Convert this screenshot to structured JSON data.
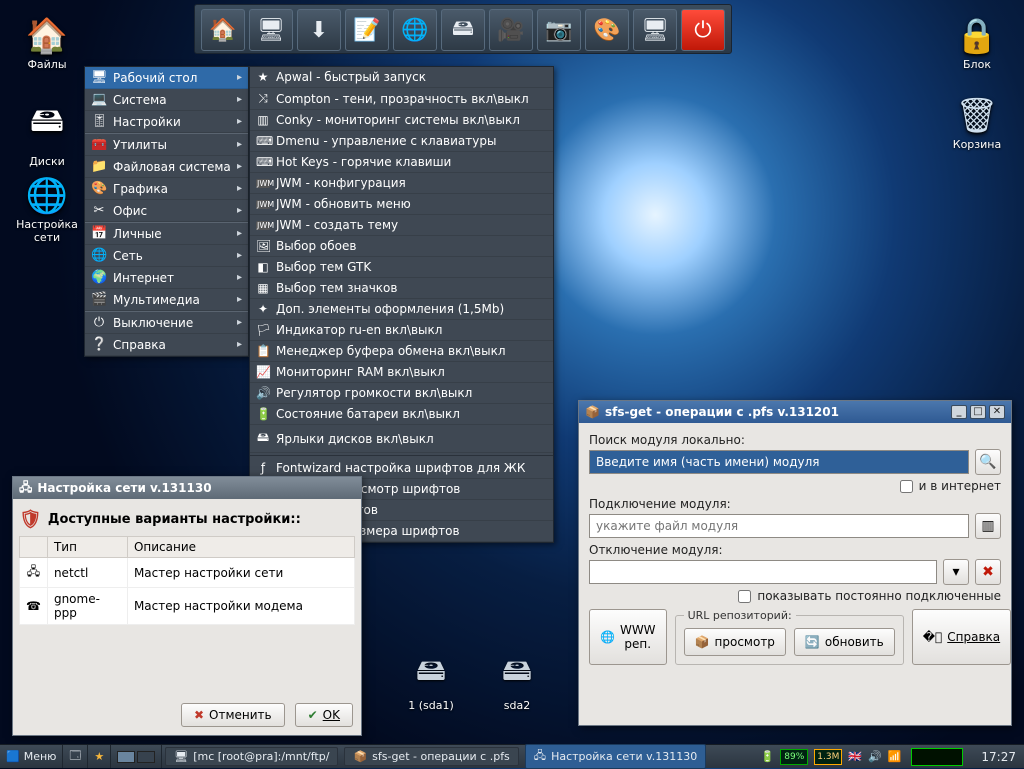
{
  "desktop_icons_left": [
    {
      "label": "Файлы",
      "glyph": "🏠"
    },
    {
      "label": "Диски",
      "glyph": "🖴"
    },
    {
      "label": "Настройка сети",
      "glyph": "🌐"
    }
  ],
  "desktop_icons_right": [
    {
      "label": "Блок",
      "glyph": "🔒"
    },
    {
      "label": "Корзина",
      "glyph": "🗑"
    }
  ],
  "launcher_icons": [
    "🏠",
    "🖥",
    "⬇",
    "📝",
    "🌐",
    "🖴",
    "🎥",
    "📷",
    "🎨",
    "🖥",
    "⏻"
  ],
  "menu": {
    "items": [
      {
        "icon": "🖥",
        "label": "Рабочий стол",
        "selected": true
      },
      {
        "icon": "💻",
        "label": "Система"
      },
      {
        "icon": "🎚",
        "label": "Настройки"
      },
      {
        "icon": "🧰",
        "label": "Утилиты",
        "sep": true
      },
      {
        "icon": "📁",
        "label": "Файловая система"
      },
      {
        "icon": "🎨",
        "label": "Графика"
      },
      {
        "icon": "✂",
        "label": "Офис"
      },
      {
        "icon": "📅",
        "label": "Личные",
        "sep": true
      },
      {
        "icon": "🌐",
        "label": "Сеть"
      },
      {
        "icon": "🌍",
        "label": "Интернет"
      },
      {
        "icon": "🎬",
        "label": "Мультимедиа"
      },
      {
        "icon": "⏻",
        "label": "Выключение",
        "sep": true
      },
      {
        "icon": "❔",
        "label": "Справка"
      }
    ]
  },
  "submenu": {
    "groups": [
      [
        {
          "icon": "★",
          "label": "Apwal - быстрый запуск"
        },
        {
          "icon": "⤨",
          "label": "Compton - тени, прозрачность вкл\\выкл"
        },
        {
          "icon": "▥",
          "label": "Conky - мониторинг системы вкл\\выкл"
        },
        {
          "icon": "⌨",
          "label": "Dmenu - управление с клавиатуры"
        },
        {
          "icon": "⌨",
          "label": "Hot Keys - горячие клавиши"
        },
        {
          "icon": "jwm",
          "label": "JWM - конфигурация"
        },
        {
          "icon": "jwm",
          "label": "JWM - обновить меню"
        },
        {
          "icon": "jwm",
          "label": "JWM - создать тему"
        },
        {
          "icon": "🖼",
          "label": "Выбор обоев"
        },
        {
          "icon": "◧",
          "label": "Выбор тем GTK"
        },
        {
          "icon": "▦",
          "label": "Выбор тем значков"
        },
        {
          "icon": "✦",
          "label": "Доп. элементы оформления (1,5Mb)"
        },
        {
          "icon": "🏳",
          "label": "Индикатор ru-en вкл\\выкл"
        },
        {
          "icon": "📋",
          "label": "Менеджер буфера обмена вкл\\выкл"
        },
        {
          "icon": "📈",
          "label": "Мониторинг RAM вкл\\выкл"
        },
        {
          "icon": "🔊",
          "label": "Регулятор громкости  вкл\\выкл"
        },
        {
          "icon": "🔋",
          "label": "Состояние батареи  вкл\\выкл"
        },
        {
          "icon": "🖴",
          "label": "Ярлыки дисков вкл\\выкл"
        }
      ],
      [
        {
          "icon": "ƒ",
          "label": "Fontwizard настройка шрифтов для ЖК"
        },
        {
          "icon": "ƒ",
          "label": "Gfontsel - просмотр шрифтов"
        },
        {
          "icon": "ƒ",
          "label": "Выбор шрифтов"
        },
        {
          "icon": "ƒ",
          "label": "Установка размера шрифтов"
        }
      ]
    ]
  },
  "win_net": {
    "title": "Настройка сети v.131130",
    "heading": "Доступные варианты настройки::",
    "cols": [
      "",
      "Тип",
      "Описание"
    ],
    "rows": [
      {
        "icon": "🖧",
        "type": "netctl",
        "desc": "Мастер настройки сети"
      },
      {
        "icon": "☎",
        "type": "gnome-ppp",
        "desc": "Мастер настройки модема"
      }
    ],
    "cancel": "Отменить",
    "ok": "OK"
  },
  "win_sfs": {
    "title": "sfs-get - операции с .pfs v.131201",
    "search_label": "Поиск модуля локально:",
    "search_placeholder": "Введите имя (часть имени) модуля",
    "chk_internet": "и в интернет",
    "connect_label": "Подключение модуля:",
    "connect_placeholder": "укажите файл модуля",
    "disconnect_label": "Отключение модуля:",
    "chk_persistent": "показывать постоянно подключенные",
    "www_btn": "WWW реп.",
    "repo_legend": "URL репозиторий:",
    "view_btn": "просмотр",
    "refresh_btn": "обновить",
    "help_btn": "Справка"
  },
  "disks": [
    {
      "label": "1 (sda1)"
    },
    {
      "label": "sda2"
    }
  ],
  "taskbar": {
    "menu": "Меню",
    "tasks": [
      {
        "icon": "🖥",
        "label": "[mc [root@pra]:/mnt/ftp/",
        "active": false
      },
      {
        "icon": "📦",
        "label": "sfs-get - операции с .pfs",
        "active": false
      },
      {
        "icon": "🖧",
        "label": "Настройка сети v.131130",
        "active": true
      }
    ],
    "battery": "89%",
    "ram": "1.3M",
    "clock": "17:27"
  }
}
